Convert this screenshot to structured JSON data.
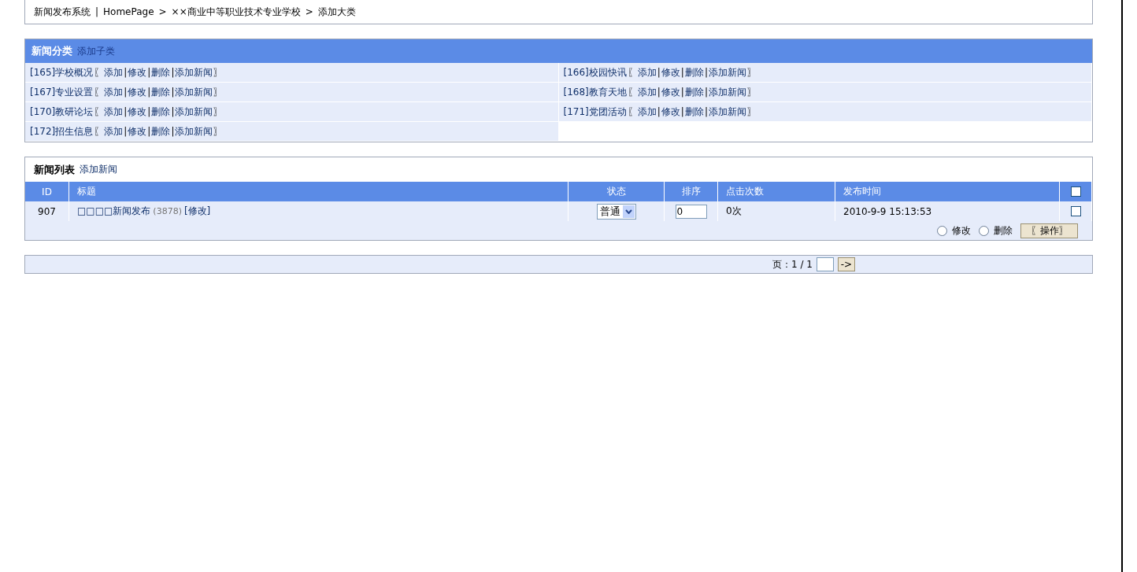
{
  "breadcrumb": {
    "system": "新闻发布系统",
    "separator": "|",
    "arrow": ">",
    "items": [
      "HomePage",
      "××商业中等职业技术专业学校",
      "添加大类"
    ]
  },
  "categories": {
    "title": "新闻分类",
    "link": "添加子类",
    "open": "〖",
    "close": "〗",
    "divider": "|",
    "items": [
      {
        "label": "[165]学校概况",
        "actions": [
          "添加",
          "修改",
          "删除",
          "添加新闻"
        ]
      },
      {
        "label": "[166]校园快讯",
        "actions": [
          "添加",
          "修改",
          "删除",
          "添加新闻"
        ]
      },
      {
        "label": "[167]专业设置",
        "actions": [
          "添加",
          "修改",
          "删除",
          "添加新闻"
        ]
      },
      {
        "label": "[168]教育天地",
        "actions": [
          "添加",
          "修改",
          "删除",
          "添加新闻"
        ]
      },
      {
        "label": "[170]教研论坛",
        "actions": [
          "添加",
          "修改",
          "删除",
          "添加新闻"
        ]
      },
      {
        "label": "[171]党团活动",
        "actions": [
          "添加",
          "修改",
          "删除",
          "添加新闻"
        ]
      },
      {
        "label": "[172]招生信息",
        "actions": [
          "添加",
          "修改",
          "删除",
          "添加新闻"
        ]
      }
    ]
  },
  "news": {
    "title": "新闻列表",
    "link": "添加新闻",
    "columns": [
      "ID",
      "标题",
      "状态",
      "排序",
      "点击次数",
      "发布时间"
    ],
    "select_all": {
      "checked": false
    },
    "rows": [
      {
        "id": "907",
        "title": "□□□□新闻发布",
        "count": "(3878)",
        "edit": "[修改]",
        "status": "普通",
        "order": "0",
        "clicks": "0次",
        "time": "2010-9-9 15:13:53",
        "checked": false
      }
    ],
    "radios": [
      {
        "label": "修改",
        "selected": false
      },
      {
        "label": "删除",
        "selected": false
      }
    ],
    "button": "〖操作〗"
  },
  "pager": {
    "label": "页：1 / 1",
    "go": "->"
  }
}
